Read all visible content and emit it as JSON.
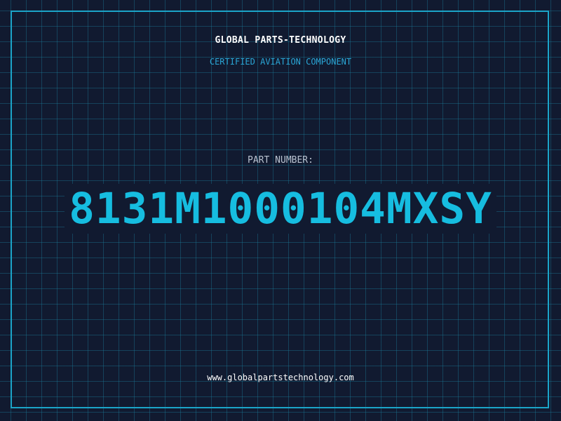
{
  "header": {
    "company": "GLOBAL PARTS-TECHNOLOGY",
    "tagline": "CERTIFIED AVIATION COMPONENT"
  },
  "part": {
    "label": "PART NUMBER:",
    "number": "8131M1000104MXSY"
  },
  "footer": {
    "website": "www.globalpartstechnology.com"
  },
  "colors": {
    "background": "#111a30",
    "grid": "#1a82a0",
    "frame": "#1ba4c8",
    "accent": "#16bde0",
    "tagline": "#2aa6d6"
  }
}
